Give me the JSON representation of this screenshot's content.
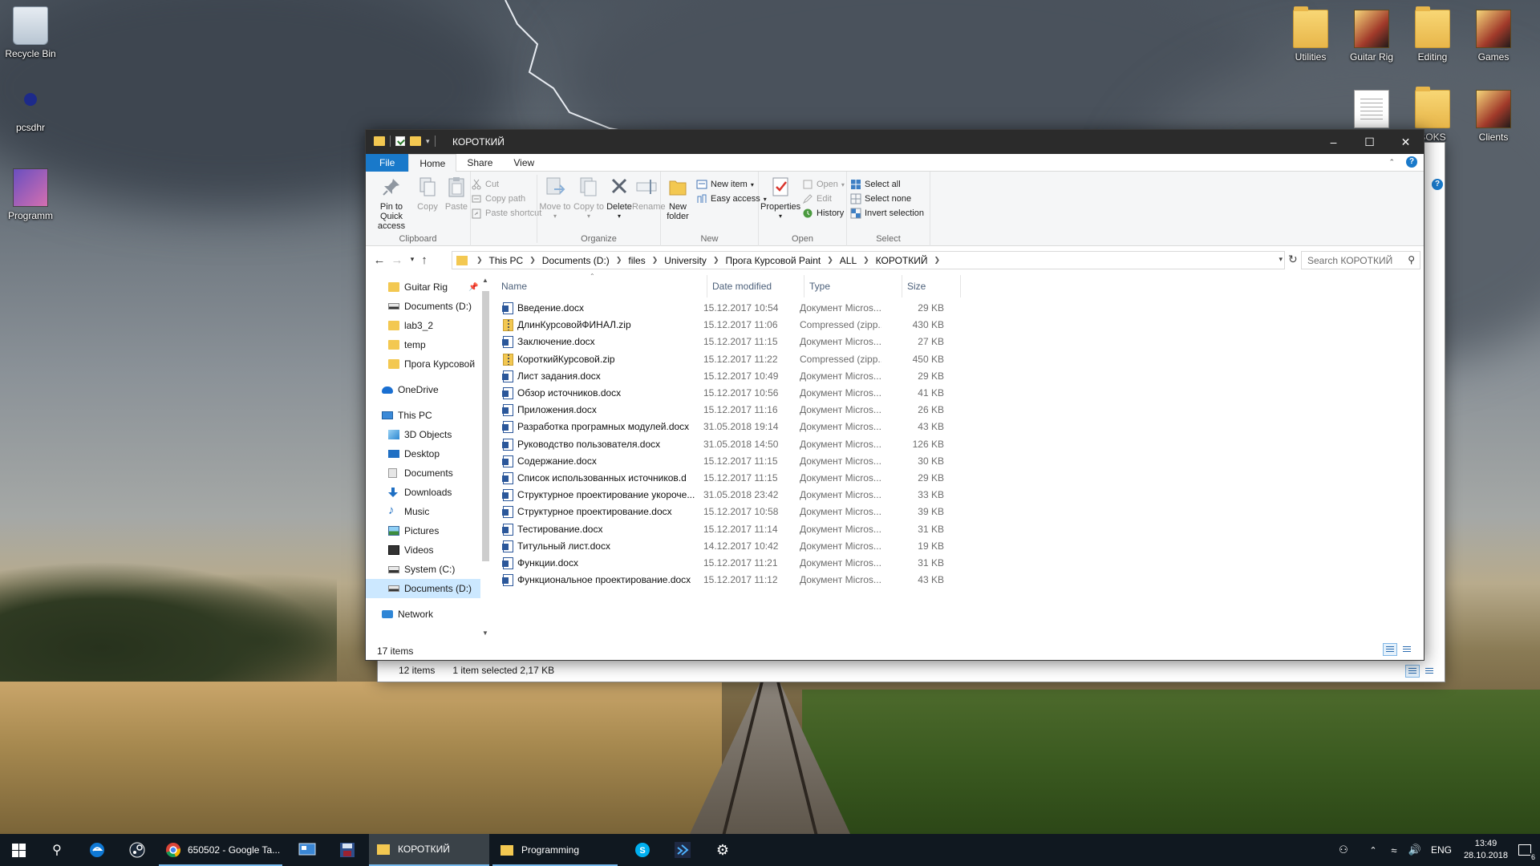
{
  "desktop": {
    "icons_left": [
      {
        "label": "Recycle Bin"
      },
      {
        "label": "pcsdhr"
      },
      {
        "label": "Programm"
      }
    ],
    "icons_right": [
      {
        "label": "Utilities"
      },
      {
        "label": "Guitar Rig"
      },
      {
        "label": "Editing"
      },
      {
        "label": "Games"
      },
      {
        "label": "SOKS"
      },
      {
        "label": "Clients"
      }
    ]
  },
  "back_window": {
    "status_items": "12 items",
    "status_selected": "1 item selected  2,17 KB"
  },
  "window": {
    "title": "КОРОТКИЙ",
    "tabs": {
      "file": "File",
      "home": "Home",
      "share": "Share",
      "view": "View"
    },
    "ribbon": {
      "clipboard": {
        "label": "Clipboard",
        "pin": "Pin to Quick access",
        "copy": "Copy",
        "paste": "Paste",
        "cut": "Cut",
        "copy_path": "Copy path",
        "paste_shortcut": "Paste shortcut"
      },
      "organize": {
        "label": "Organize",
        "move_to": "Move to",
        "copy_to": "Copy to",
        "delete": "Delete",
        "rename": "Rename"
      },
      "new": {
        "label": "New",
        "new_folder": "New folder",
        "new_item": "New item",
        "easy_access": "Easy access"
      },
      "open": {
        "label": "Open",
        "properties": "Properties",
        "open": "Open",
        "edit": "Edit",
        "history": "History"
      },
      "select": {
        "label": "Select",
        "select_all": "Select all",
        "select_none": "Select none",
        "invert": "Invert selection"
      }
    },
    "breadcrumb": [
      "This PC",
      "Documents (D:)",
      "files",
      "University",
      "Прога Курсовой Paint",
      "ALL",
      "КОРОТКИЙ"
    ],
    "search_placeholder": "Search КОРОТКИЙ",
    "nav_pane": [
      {
        "label": "Guitar Rig",
        "icon": "folder-icon"
      },
      {
        "label": "Documents (D:)",
        "icon": "drive-icon"
      },
      {
        "label": "lab3_2",
        "icon": "folder-icon"
      },
      {
        "label": "temp",
        "icon": "folder-icon"
      },
      {
        "label": "Прога Курсовой",
        "icon": "folder-icon"
      },
      {
        "label": "OneDrive",
        "icon": "cloud-icon"
      },
      {
        "label": "This PC",
        "icon": "pc-icon"
      },
      {
        "label": "3D Objects",
        "icon": "cube-icon"
      },
      {
        "label": "Desktop",
        "icon": "desktop-icon"
      },
      {
        "label": "Documents",
        "icon": "documents-icon"
      },
      {
        "label": "Downloads",
        "icon": "download-icon"
      },
      {
        "label": "Music",
        "icon": "music-icon"
      },
      {
        "label": "Pictures",
        "icon": "pictures-icon"
      },
      {
        "label": "Videos",
        "icon": "videos-icon"
      },
      {
        "label": "System (C:)",
        "icon": "system-drive-icon"
      },
      {
        "label": "Documents (D:)",
        "icon": "drive-icon"
      },
      {
        "label": "Network",
        "icon": "network-icon"
      }
    ],
    "columns": {
      "name": "Name",
      "date": "Date modified",
      "type": "Type",
      "size": "Size"
    },
    "files": [
      {
        "name": "Введение.docx",
        "date": "15.12.2017 10:54",
        "type": "Документ Micros...",
        "size": "29 KB",
        "kind": "word"
      },
      {
        "name": "ДлинКурсовойФИНАЛ.zip",
        "date": "15.12.2017 11:06",
        "type": "Compressed (zipp...",
        "size": "430 KB",
        "kind": "zip"
      },
      {
        "name": "Заключение.docx",
        "date": "15.12.2017 11:15",
        "type": "Документ Micros...",
        "size": "27 KB",
        "kind": "word"
      },
      {
        "name": "КороткийКурсовой.zip",
        "date": "15.12.2017 11:22",
        "type": "Compressed (zipp...",
        "size": "450 KB",
        "kind": "zip"
      },
      {
        "name": "Лист задания.docx",
        "date": "15.12.2017 10:49",
        "type": "Документ Micros...",
        "size": "29 KB",
        "kind": "word"
      },
      {
        "name": "Обзор источников.docx",
        "date": "15.12.2017 10:56",
        "type": "Документ Micros...",
        "size": "41 KB",
        "kind": "word"
      },
      {
        "name": "Приложения.docx",
        "date": "15.12.2017 11:16",
        "type": "Документ Micros...",
        "size": "26 KB",
        "kind": "word"
      },
      {
        "name": "Разработка програмных модулей.docx",
        "date": "31.05.2018 19:14",
        "type": "Документ Micros...",
        "size": "43 KB",
        "kind": "word"
      },
      {
        "name": "Руководство пользователя.docx",
        "date": "31.05.2018 14:50",
        "type": "Документ Micros...",
        "size": "126 KB",
        "kind": "word"
      },
      {
        "name": "Содержание.docx",
        "date": "15.12.2017 11:15",
        "type": "Документ Micros...",
        "size": "30 KB",
        "kind": "word"
      },
      {
        "name": "Список использованных источников.d",
        "date": "15.12.2017 11:15",
        "type": "Документ Micros...",
        "size": "29 KB",
        "kind": "word"
      },
      {
        "name": "Структурное проектирование укороче...",
        "date": "31.05.2018 23:42",
        "type": "Документ Micros...",
        "size": "33 KB",
        "kind": "word"
      },
      {
        "name": "Структурное проектирование.docx",
        "date": "15.12.2017 10:58",
        "type": "Документ Micros...",
        "size": "39 KB",
        "kind": "word"
      },
      {
        "name": "Тестирование.docx",
        "date": "15.12.2017 11:14",
        "type": "Документ Micros...",
        "size": "31 KB",
        "kind": "word"
      },
      {
        "name": "Титульный лист.docx",
        "date": "14.12.2017 10:42",
        "type": "Документ Micros...",
        "size": "19 KB",
        "kind": "word"
      },
      {
        "name": "Функции.docx",
        "date": "15.12.2017 11:21",
        "type": "Документ Micros...",
        "size": "31 KB",
        "kind": "word"
      },
      {
        "name": "Функциональное проектирование.docx",
        "date": "15.12.2017 11:12",
        "type": "Документ Micros...",
        "size": "43 KB",
        "kind": "word"
      }
    ],
    "status_count": "17 items"
  },
  "taskbar": {
    "apps": [
      {
        "label": "650502 - Google Ta..."
      },
      {
        "label": "КОРОТКИЙ"
      },
      {
        "label": "Programming"
      }
    ],
    "lang": "ENG",
    "time": "13:49",
    "date": "28.10.2018",
    "notifications": "6"
  },
  "colors": {
    "accent": "#1979ca",
    "titlebar": "#2b2b2b",
    "taskbar": "#101820",
    "selection": "#cce8ff"
  }
}
